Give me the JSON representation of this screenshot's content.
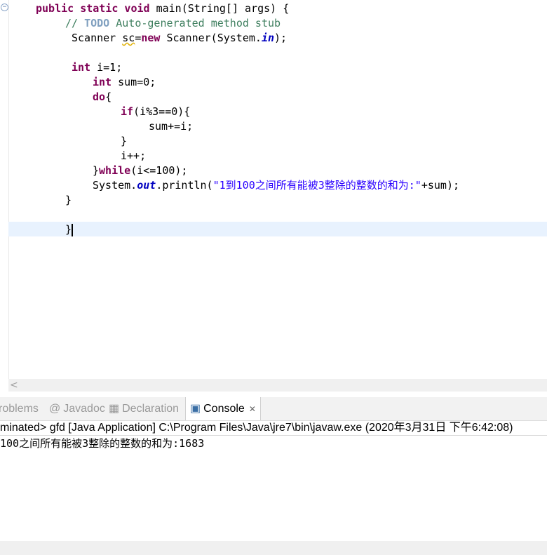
{
  "code": {
    "l1_kw": "public static void",
    "l1_rest": " main(String[] args) {",
    "l2_comment_start": "// ",
    "l2_todo": "TODO",
    "l2_comment_rest": " Auto-generated method stub",
    "l3_pre": "Scanner ",
    "l3_sc": "sc",
    "l3_eq": "=",
    "l3_new": "new",
    "l3_mid": " Scanner(System.",
    "l3_in": "in",
    "l3_end": ");",
    "l5_kw": "int",
    "l5_rest": " i=1;",
    "l6_kw": "int",
    "l6_rest": " sum=0;",
    "l7_kw": "do",
    "l7_rest": "{",
    "l8_kw": "if",
    "l8_rest": "(i%3==0){",
    "l9": "sum+=i;",
    "l10": "}",
    "l11": "i++;",
    "l12_pre": "}",
    "l12_kw": "while",
    "l12_rest": "(i<=100);",
    "l13_pre": "System.",
    "l13_out": "out",
    "l13_mid": ".println(",
    "l13_str": "\"1到100之间所有能被3整除的整数的和为:\"",
    "l13_end": "+sum);",
    "l14": "}",
    "l16": "}"
  },
  "tabs": {
    "problems": "roblems",
    "javadoc": "Javadoc",
    "declaration": "Declaration",
    "console": "Console",
    "console_close": "✕",
    "javadoc_icon": "@",
    "declaration_icon": "▦",
    "console_icon": "▣"
  },
  "console": {
    "status": "minated> gfd [Java Application] C:\\Program Files\\Java\\jre7\\bin\\javaw.exe (2020年3月31日 下午6:42:08)",
    "output": "100之间所有能被3整除的整数的和为:1683"
  },
  "icons": {
    "fold": "−",
    "scroll_left": "<"
  }
}
